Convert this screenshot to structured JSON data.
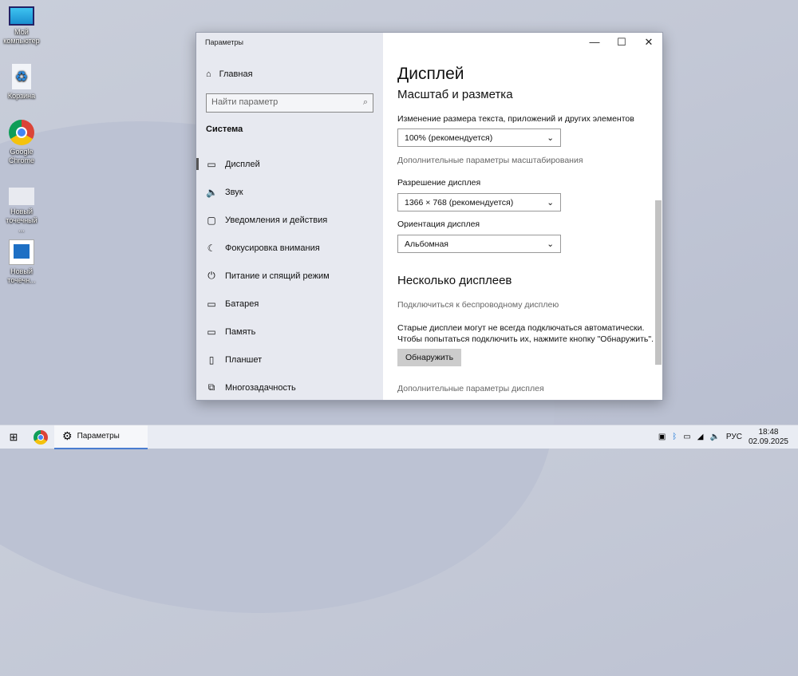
{
  "desktop": {
    "icons": [
      "Мой компьютер",
      "Корзина",
      "Google Chrome",
      "Новый точечный ...",
      "Новый точечн..."
    ]
  },
  "window": {
    "title": "Параметры",
    "home": "Главная",
    "search_placeholder": "Найти параметр",
    "section": "Система",
    "nav": [
      {
        "icon": "▭",
        "label": "Дисплей"
      },
      {
        "icon": "🔈",
        "label": "Звук"
      },
      {
        "icon": "▢",
        "label": "Уведомления и действия"
      },
      {
        "icon": "☾",
        "label": "Фокусировка внимания"
      },
      {
        "icon": "⏻",
        "label": "Питание и спящий режим"
      },
      {
        "icon": "▭",
        "label": "Батарея"
      },
      {
        "icon": "▭",
        "label": "Память"
      },
      {
        "icon": "▯",
        "label": "Планшет"
      },
      {
        "icon": "⧉",
        "label": "Многозадачность"
      }
    ],
    "controls": {
      "minimize": "—",
      "maximize": "☐",
      "close": "✕"
    }
  },
  "main": {
    "title": "Дисплей",
    "scale_heading": "Масштаб и разметка",
    "scale_label": "Изменение размера текста, приложений и других элементов",
    "scale_value": "100% (рекомендуется)",
    "scale_link": "Дополнительные параметры масштабирования",
    "res_label": "Разрешение дисплея",
    "res_value": "1366 × 768 (рекомендуется)",
    "orient_label": "Ориентация дисплея",
    "orient_value": "Альбомная",
    "multi_heading": "Несколько дисплеев",
    "wireless_link": "Подключиться к беспроводному дисплею",
    "old_text1": "Старые дисплеи могут не всегда подключаться автоматически.",
    "old_text2": "Чтобы попытаться подключить их, нажмите кнопку \"Обнаружить\".",
    "detect": "Обнаружить",
    "adv_link": "Дополнительные параметры дисплея"
  },
  "taskbar": {
    "app": "Параметры",
    "lang": "РУС",
    "time": "18:48",
    "date": "02.09.2025"
  }
}
